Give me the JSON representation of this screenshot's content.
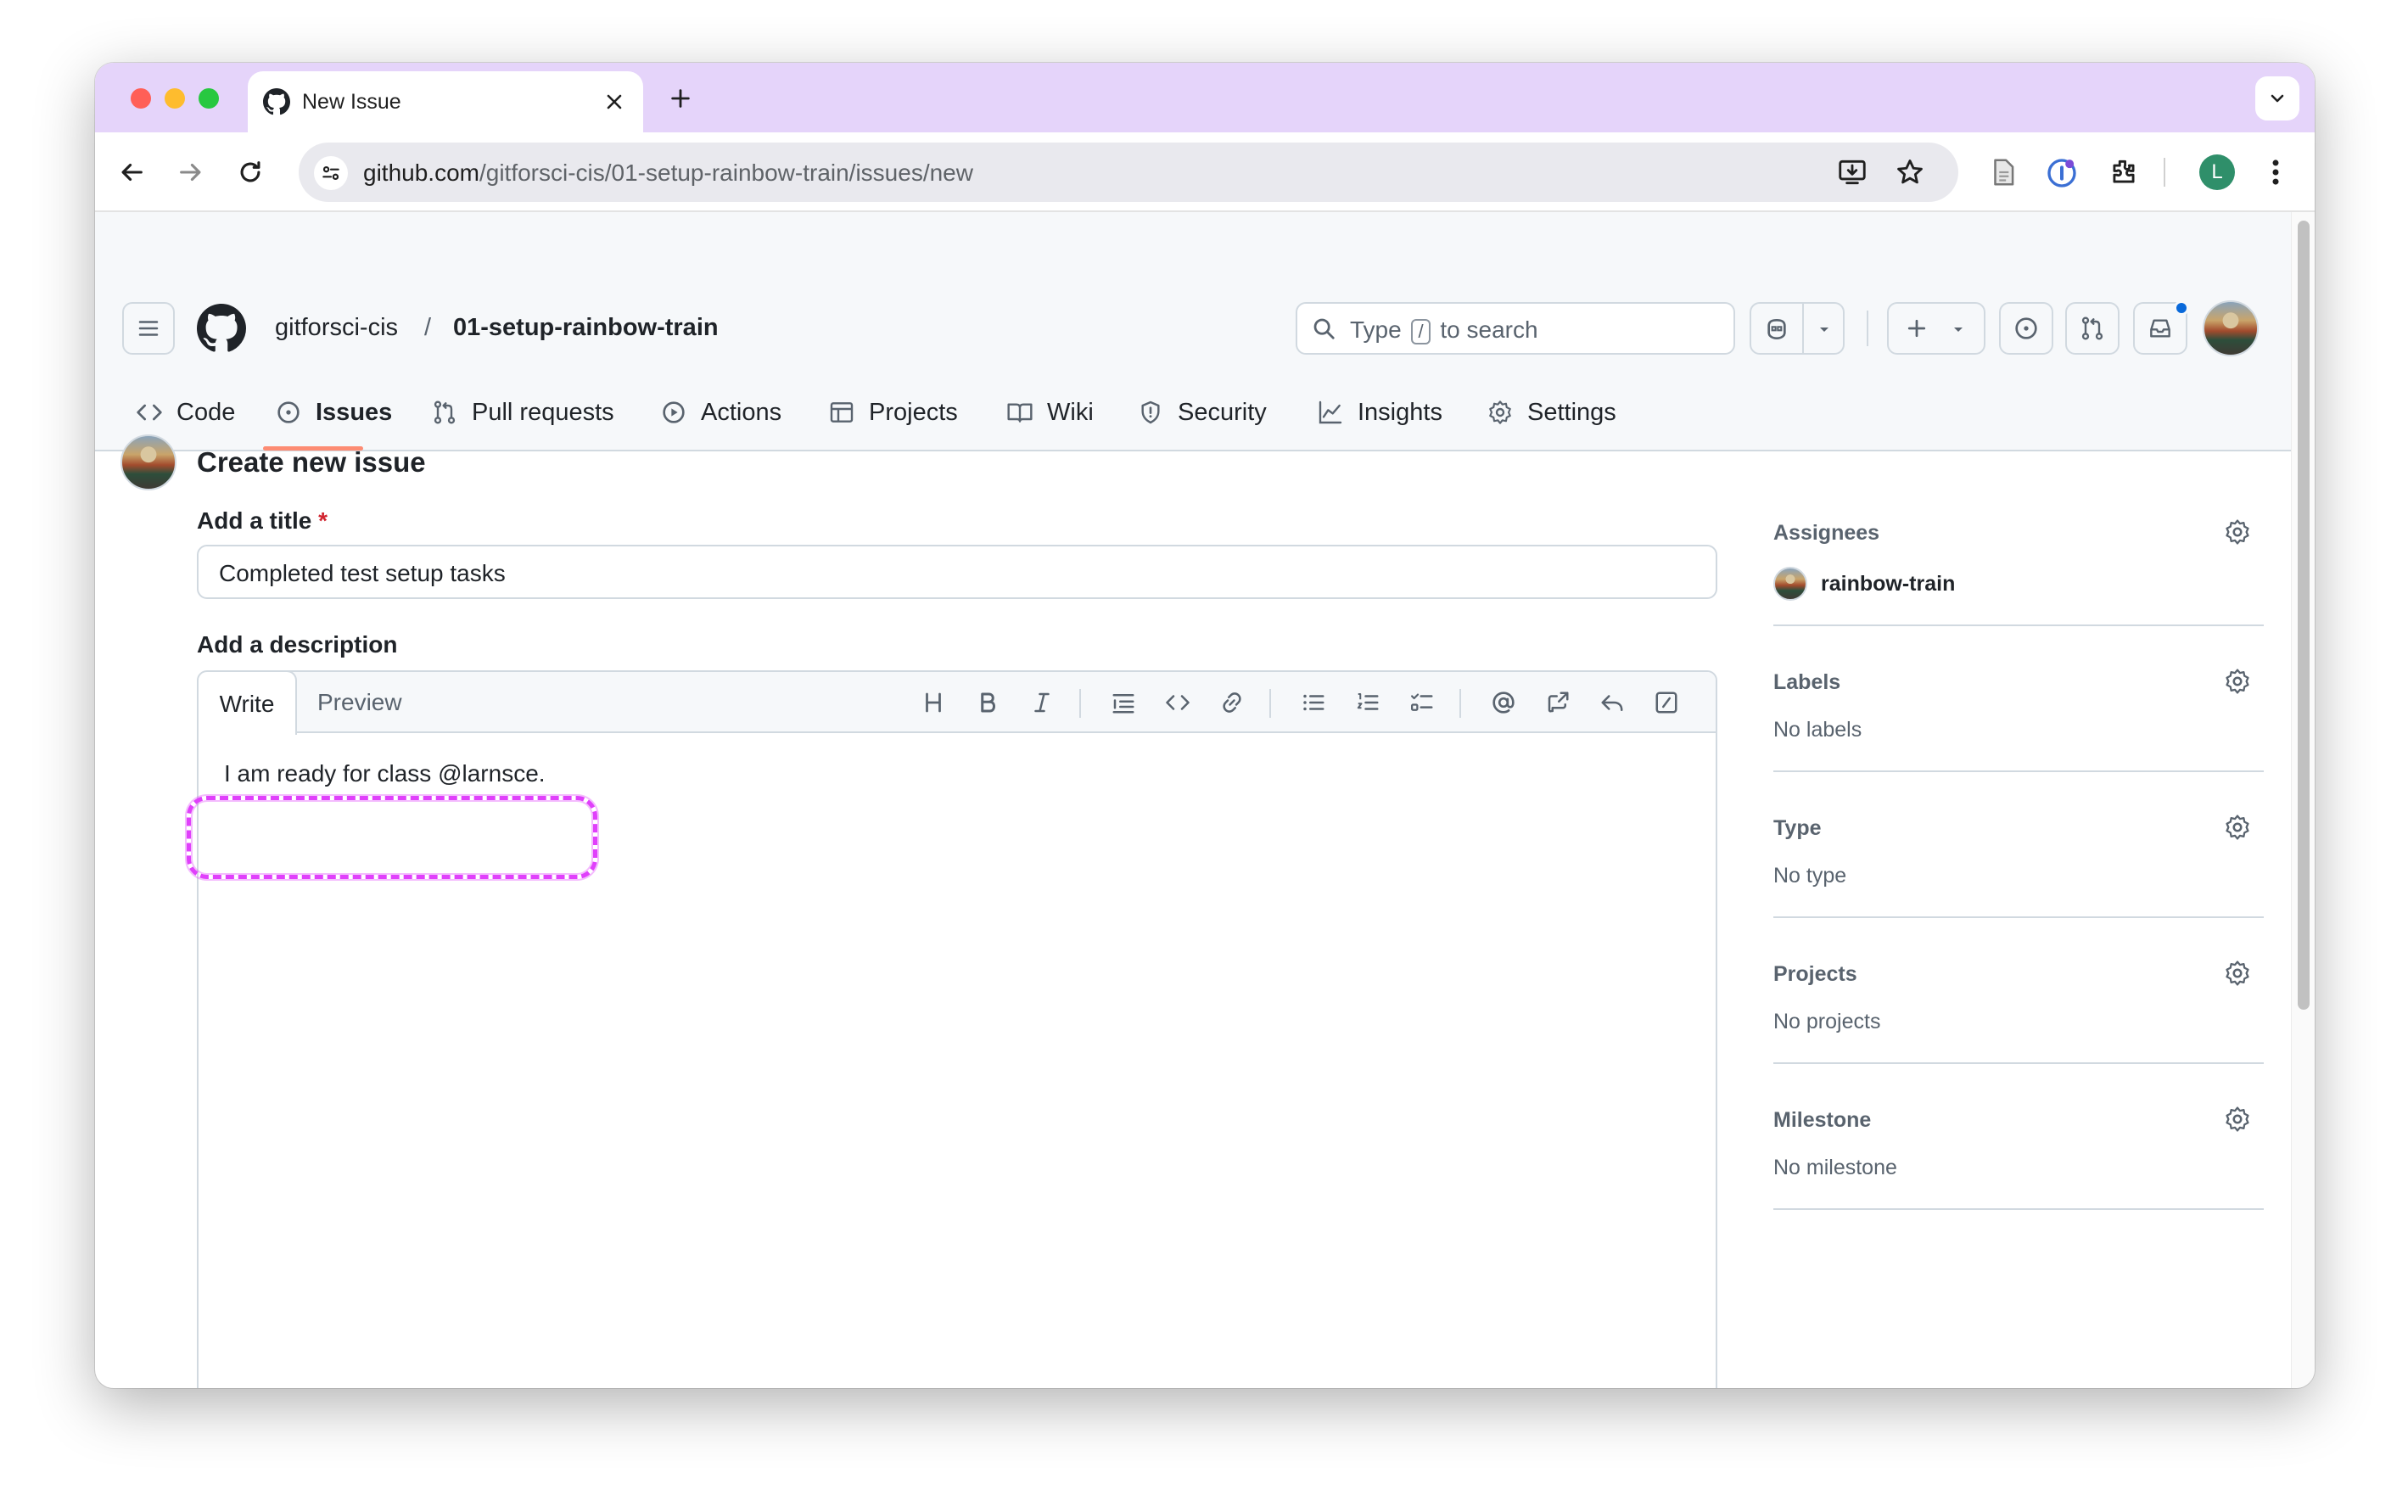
{
  "browser": {
    "tab_title": "New Issue",
    "url_host": "github.com",
    "url_path": "/gitforsci-cis/01-setup-rainbow-train/issues/new",
    "profile_initial": "L"
  },
  "header": {
    "owner": "gitforsci-cis",
    "separator": "/",
    "repo": "01-setup-rainbow-train",
    "search_prefix": "Type",
    "search_key": "/",
    "search_suffix": "to search"
  },
  "repo_nav": [
    {
      "label": "Code",
      "icon": "code-icon"
    },
    {
      "label": "Issues",
      "icon": "issue-opened-icon",
      "active": true
    },
    {
      "label": "Pull requests",
      "icon": "git-pull-request-icon"
    },
    {
      "label": "Actions",
      "icon": "play-icon"
    },
    {
      "label": "Projects",
      "icon": "table-icon"
    },
    {
      "label": "Wiki",
      "icon": "book-icon"
    },
    {
      "label": "Security",
      "icon": "shield-icon"
    },
    {
      "label": "Insights",
      "icon": "graph-icon"
    },
    {
      "label": "Settings",
      "icon": "gear-icon"
    }
  ],
  "form": {
    "heading": "Create new issue",
    "title_label": "Add a title",
    "required_mark": "*",
    "title_value": "Completed test setup tasks",
    "description_label": "Add a description",
    "tab_write": "Write",
    "tab_preview": "Preview",
    "toolbar_icons": [
      "heading-icon",
      "bold-icon",
      "italic-icon",
      "quote-icon",
      "code-icon",
      "link-icon",
      "unordered-list-icon",
      "ordered-list-icon",
      "task-list-icon",
      "mention-icon",
      "cross-reference-icon",
      "reply-icon",
      "slash-commands-icon"
    ],
    "body_value": "I am ready for class @larnsce."
  },
  "sidebar": {
    "assignees_label": "Assignees",
    "assignee_name": "rainbow-train",
    "labels_label": "Labels",
    "labels_value": "No labels",
    "type_label": "Type",
    "type_value": "No type",
    "projects_label": "Projects",
    "projects_value": "No projects",
    "milestone_label": "Milestone",
    "milestone_value": "No milestone"
  },
  "colors": {
    "tabstrip": "#e5d4fa",
    "active_tab_underline": "#fd8c73",
    "annotation": "#e040fb",
    "required": "#d1242f"
  }
}
